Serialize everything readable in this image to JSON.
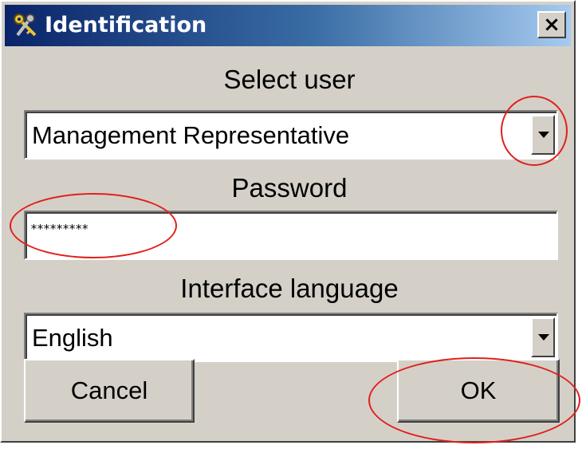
{
  "window": {
    "title": "Identification",
    "close_glyph": "×",
    "icon": "keys-icon"
  },
  "select_user": {
    "label": "Select user",
    "value": "Management Representative"
  },
  "password": {
    "label": "Password",
    "value": "*********"
  },
  "interface_language": {
    "label": "Interface language",
    "value": "English"
  },
  "buttons": {
    "cancel": "Cancel",
    "ok": "OK"
  },
  "colors": {
    "title_gradient_start": "#0a246a",
    "window_face": "#d4d0c8",
    "annotation_red": "#e0201c"
  }
}
